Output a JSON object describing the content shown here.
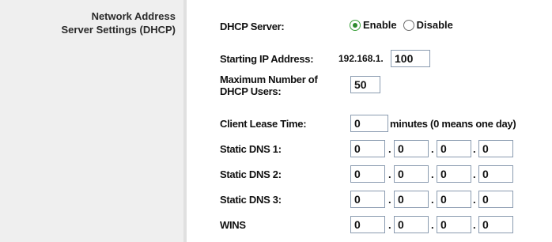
{
  "section": {
    "title_line1": "Network Address",
    "title_line2": "Server Settings (DHCP)"
  },
  "dhcp_server": {
    "label": "DHCP Server:",
    "options": [
      {
        "label": "Enable",
        "selected": true
      },
      {
        "label": "Disable",
        "selected": false
      }
    ]
  },
  "starting_ip": {
    "label": "Starting IP Address:",
    "prefix": "192.168.1.",
    "last_octet": "100"
  },
  "max_users": {
    "label_line1": "Maximum Number of",
    "label_line2": "DHCP Users:",
    "value": "50"
  },
  "lease_time": {
    "label": "Client Lease Time:",
    "value": "0",
    "suffix": "minutes (0 means one day)"
  },
  "dns": [
    {
      "label": "Static DNS 1:",
      "octets": [
        "0",
        "0",
        "0",
        "0"
      ]
    },
    {
      "label": "Static DNS 2:",
      "octets": [
        "0",
        "0",
        "0",
        "0"
      ]
    },
    {
      "label": "Static DNS 3:",
      "octets": [
        "0",
        "0",
        "0",
        "0"
      ]
    },
    {
      "label": "WINS",
      "octets": [
        "0",
        "0",
        "0",
        "0"
      ]
    }
  ],
  "colors": {
    "radio_selected": "#2e8b2e",
    "input_border": "#8a9bb0",
    "left_panel": "#efefef"
  }
}
